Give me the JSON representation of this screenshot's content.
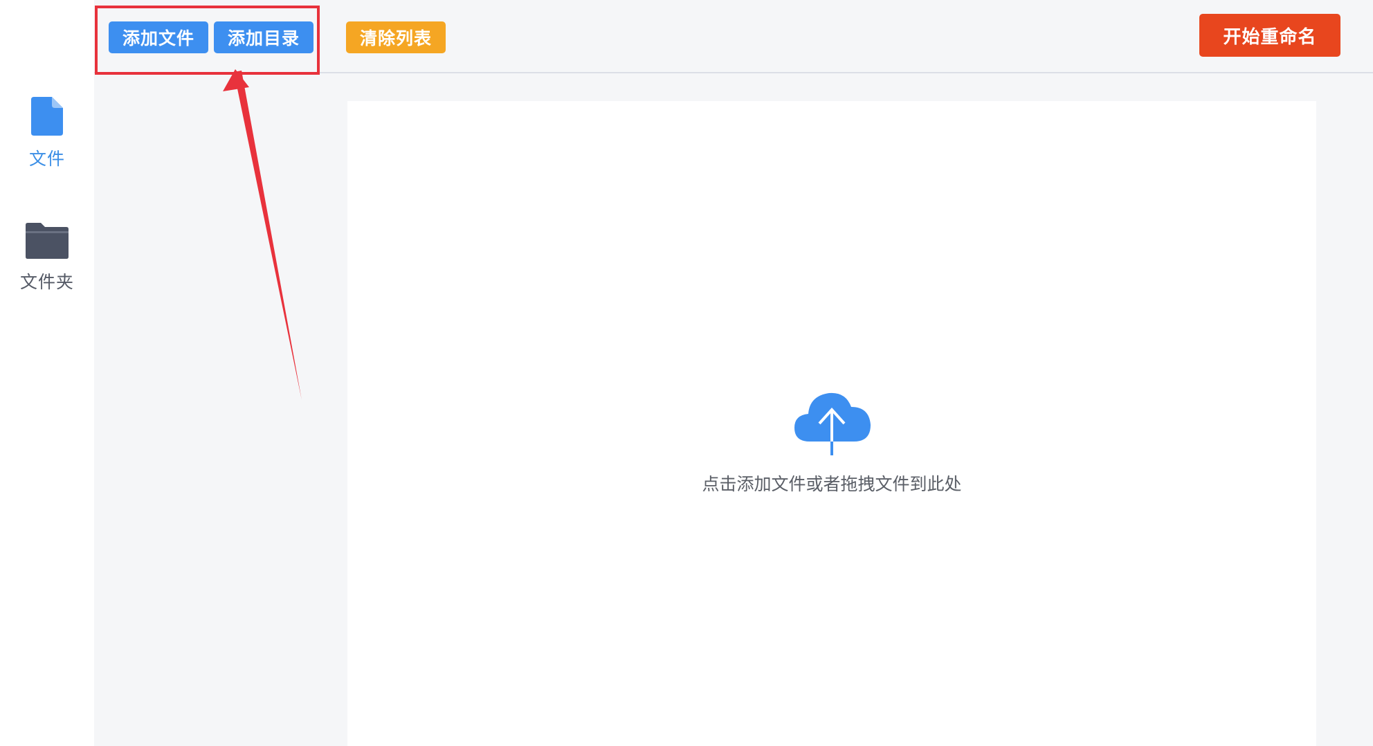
{
  "sidebar": {
    "items": [
      {
        "label": "文件",
        "icon": "file-icon",
        "active": true
      },
      {
        "label": "文件夹",
        "icon": "folder-icon",
        "active": false
      }
    ]
  },
  "toolbar": {
    "add_file_label": "添加文件",
    "add_dir_label": "添加目录",
    "clear_label": "清除列表",
    "start_label": "开始重命名"
  },
  "dropzone": {
    "hint": "点击添加文件或者拖拽文件到此处",
    "icon": "cloud-upload-icon"
  },
  "colors": {
    "primary_blue": "#3d8ff0",
    "warning_orange": "#f5a623",
    "danger_red": "#e8461e",
    "annotation_red": "#e8323c"
  }
}
